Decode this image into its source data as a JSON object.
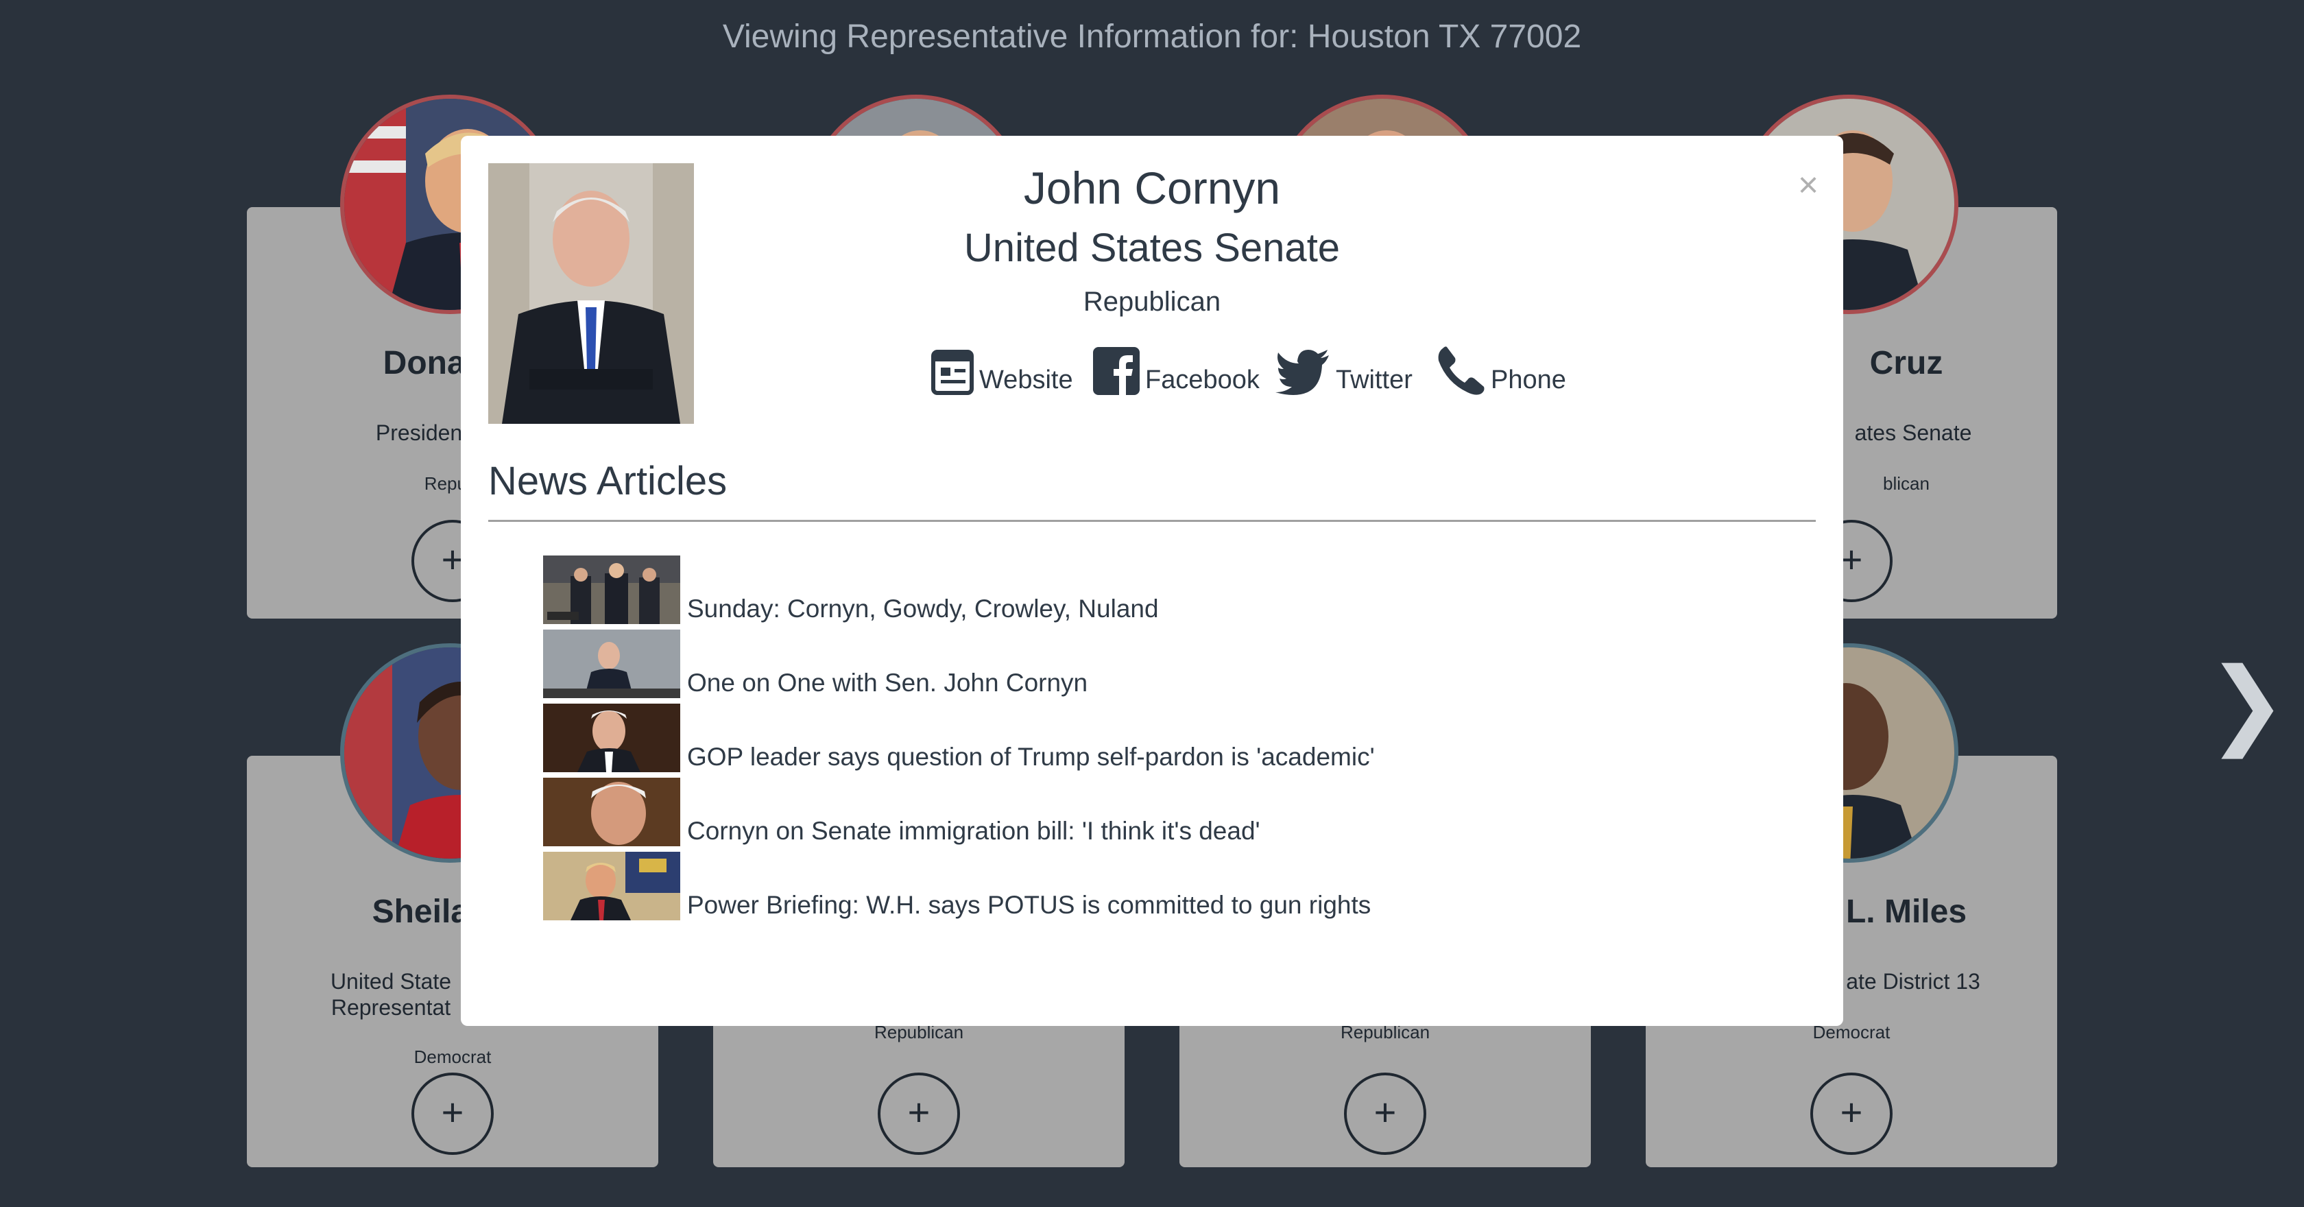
{
  "header": {
    "title": "Viewing Representative Information for: Houston TX 77002"
  },
  "cards": [
    {
      "name": "Donald J",
      "title": "President of the",
      "party": "Republ",
      "expand_label": "+"
    },
    {
      "name": "",
      "title": "",
      "party": "",
      "expand_label": "+"
    },
    {
      "name": "",
      "title": "",
      "party": "",
      "expand_label": "+"
    },
    {
      "name": "Cruz",
      "title": "ates Senate",
      "party": "blican",
      "expand_label": "+"
    },
    {
      "name": "Sheila Jac",
      "title": "United State Representat",
      "party": "Democrat",
      "expand_label": "+"
    },
    {
      "name": "",
      "title": "",
      "party": "Republican",
      "expand_label": "+"
    },
    {
      "name": "",
      "title": "",
      "party": "Republican",
      "expand_label": "+"
    },
    {
      "name": "L. Miles",
      "title": "ate District 13",
      "party": "Democrat",
      "expand_label": "+"
    }
  ],
  "next_arrow": "❯",
  "modal": {
    "name": "John Cornyn",
    "office": "United States Senate",
    "party": "Republican",
    "close_label": "×",
    "links": {
      "website": "Website",
      "facebook": "Facebook",
      "twitter": "Twitter",
      "phone": "Phone"
    },
    "news_heading": "News Articles",
    "articles": [
      {
        "title": "Sunday: Cornyn, Gowdy, Crowley, Nuland"
      },
      {
        "title": "One on One with Sen. John Cornyn"
      },
      {
        "title": "GOP leader says question of Trump self-pardon is 'academic'"
      },
      {
        "title": "Cornyn on Senate immigration bill: 'I think it's dead'"
      },
      {
        "title": "Power Briefing: W.H. says POTUS is committed to gun rights"
      }
    ]
  },
  "colors": {
    "background": "#2a323c",
    "card": "#a7a7a7",
    "republican_ring": "#a94c4f",
    "democrat_ring": "#4e6f7e",
    "text_dark": "#2f3a46"
  }
}
